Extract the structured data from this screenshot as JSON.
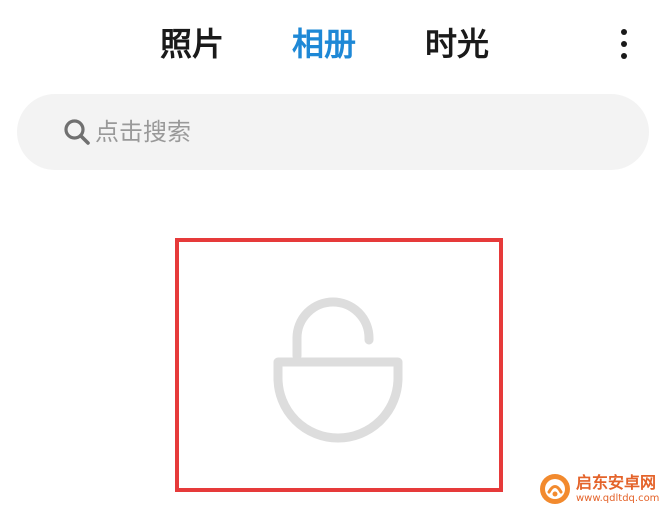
{
  "header": {
    "tabs": [
      {
        "label": "照片",
        "active": false
      },
      {
        "label": "相册",
        "active": true
      },
      {
        "label": "时光",
        "active": false
      }
    ],
    "more_icon": "more-vertical-icon"
  },
  "search": {
    "placeholder": "点击搜索",
    "icon": "search-icon"
  },
  "content": {
    "tile_icon": "unlocked-padlock-icon",
    "highlight_color": "#e63a3a"
  },
  "colors": {
    "accent": "#1e88d6",
    "tab_text": "#1a1a1a",
    "search_bg": "#f3f3f3",
    "icon_gray": "#dddddd"
  },
  "watermark": {
    "title": "启东安卓网",
    "url": "www.qdltdq.com"
  }
}
